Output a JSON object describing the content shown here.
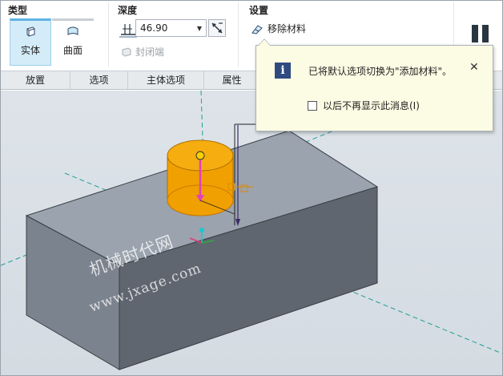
{
  "ribbon": {
    "type_group": {
      "title": "类型",
      "solid_label": "实体",
      "surface_label": "曲面"
    },
    "depth_group": {
      "title": "深度",
      "depth_value": "46.90",
      "cap_ends_label": "封闭端"
    },
    "settings_group": {
      "title": "设置",
      "remove_material_label": "移除材料"
    }
  },
  "tabs": [
    {
      "label": "放置"
    },
    {
      "label": "选项"
    },
    {
      "label": "主体选项"
    },
    {
      "label": "属性"
    }
  ],
  "popup": {
    "message": "已将默认选项切换为\"添加材料\"。",
    "close_glyph": "✕",
    "checkbox_label": "以后不再显示此消息(I)",
    "checkbox_checked": false
  },
  "watermark": {
    "line1": "机械时代网",
    "line2": "www.jxage.com"
  },
  "colors": {
    "accent": "#5fb2e5",
    "feature_orange": "#f0a000",
    "block_top": "#99a2ad",
    "block_front": "#5e6570",
    "popup_bg": "#fcfce4",
    "info_icon": "#2f4a80"
  },
  "icons": [
    "solid-icon",
    "surface-icon",
    "depth-blind-icon",
    "flip-direction-icon",
    "cap-ends-icon",
    "remove-material-icon",
    "pause-icon",
    "info-icon",
    "close-icon"
  ]
}
